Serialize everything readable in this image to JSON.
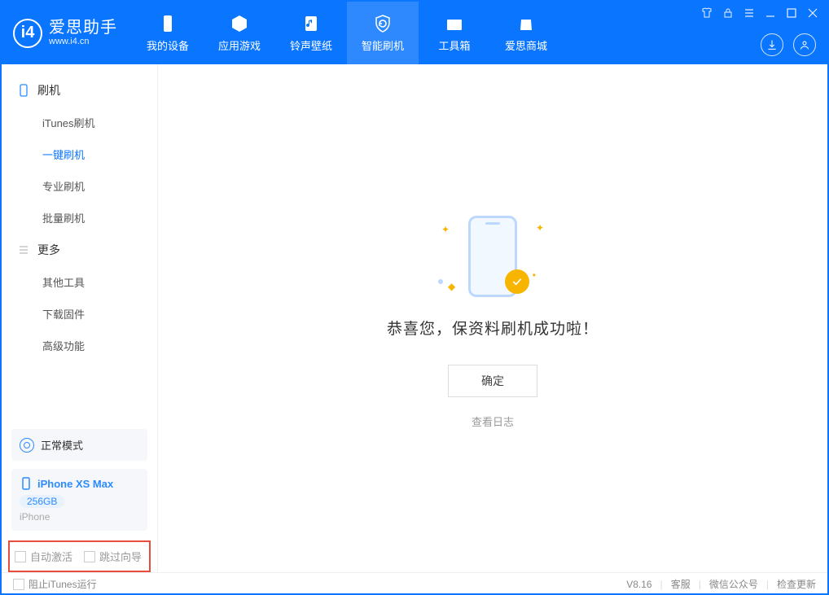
{
  "app": {
    "name_cn": "爱思助手",
    "name_en": "www.i4.cn"
  },
  "nav": [
    {
      "key": "device",
      "label": "我的设备"
    },
    {
      "key": "apps",
      "label": "应用游戏"
    },
    {
      "key": "ringwall",
      "label": "铃声壁纸"
    },
    {
      "key": "smartflash",
      "label": "智能刷机"
    },
    {
      "key": "toolbox",
      "label": "工具箱"
    },
    {
      "key": "store",
      "label": "爱思商城"
    }
  ],
  "sidebar": {
    "cat1": "刷机",
    "items1": [
      "iTunes刷机",
      "一键刷机",
      "专业刷机",
      "批量刷机"
    ],
    "cat2": "更多",
    "items2": [
      "其他工具",
      "下载固件",
      "高级功能"
    ]
  },
  "mode": {
    "label": "正常模式"
  },
  "device": {
    "name": "iPhone XS Max",
    "storage": "256GB",
    "type": "iPhone"
  },
  "options": {
    "auto_activate": "自动激活",
    "skip_guide": "跳过向导"
  },
  "main": {
    "message": "恭喜您，保资料刷机成功啦！",
    "confirm": "确定",
    "view_log": "查看日志"
  },
  "footer": {
    "block_itunes": "阻止iTunes运行",
    "version": "V8.16",
    "support": "客服",
    "wechat": "微信公众号",
    "update": "检查更新"
  }
}
